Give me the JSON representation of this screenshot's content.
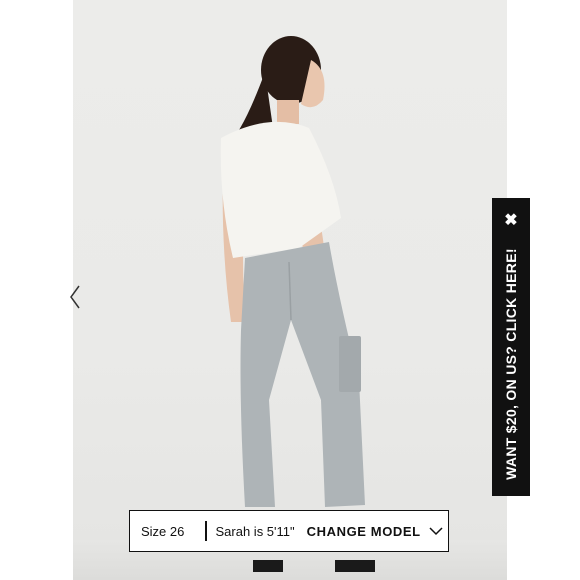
{
  "carousel": {
    "prev_icon": "chevron-left-icon"
  },
  "promo": {
    "text": "WANT $20, ON US? CLICK HERE!",
    "close_glyph": "✖",
    "close_icon": "close-icon",
    "background": "#111111",
    "text_color": "#ffffff"
  },
  "fit_bar": {
    "size_text": "Size 26",
    "model_text": "Sarah is 5'11\"",
    "change_model_label": "CHANGE MODEL",
    "dropdown_icon": "chevron-down-icon"
  },
  "colors": {
    "backdrop": "#ececea",
    "pants": "#aeb4b7",
    "top": "#f4f3ef",
    "hair": "#2a1c16"
  }
}
